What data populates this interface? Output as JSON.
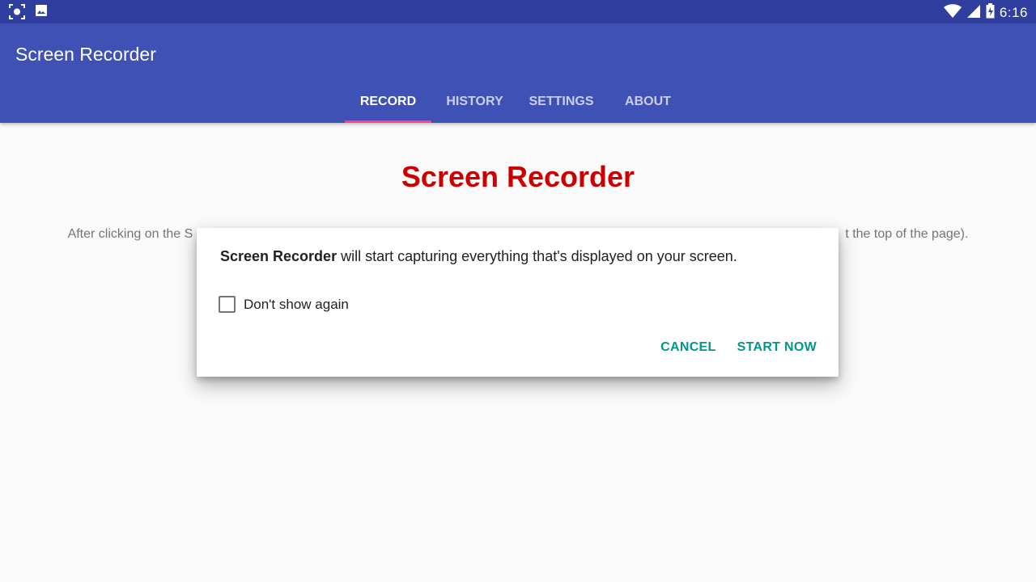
{
  "status_bar": {
    "time": "6:16",
    "left_icons": [
      "screenshot-icon",
      "image-icon"
    ],
    "right_icons": [
      "wifi-icon",
      "cell-signal-icon",
      "battery-icon"
    ]
  },
  "app_bar": {
    "title": "Screen Recorder",
    "color": "#3f51b5",
    "tabs": [
      {
        "label": "RECORD",
        "active": true
      },
      {
        "label": "HISTORY",
        "active": false
      },
      {
        "label": "SETTINGS",
        "active": false
      },
      {
        "label": "ABOUT",
        "active": false
      }
    ],
    "indicator_color": "#ff4081"
  },
  "content": {
    "title": "Screen Recorder",
    "title_color": "#cc0000",
    "text_left": "After clicking on the S",
    "text_right": "t the top of the page)."
  },
  "dialog": {
    "app_name": "Screen Recorder",
    "message": " will start capturing everything that's displayed on your screen.",
    "checkbox_label": "Don't show again",
    "checkbox_checked": false,
    "cancel_label": "CANCEL",
    "start_label": "START NOW",
    "accent_color": "#009688"
  }
}
